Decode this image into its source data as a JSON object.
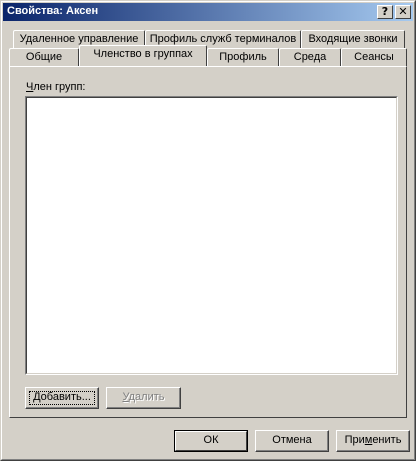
{
  "window": {
    "title": "Свойства: Аксен",
    "help_glyph": "?",
    "close_glyph": "✕"
  },
  "tabs_row1": [
    {
      "label": "Удаленное управление"
    },
    {
      "label": "Профиль служб терминалов"
    },
    {
      "label": "Входящие звонки"
    }
  ],
  "tabs_row2": [
    {
      "label": "Общие"
    },
    {
      "label": "Членство в группах",
      "active": true
    },
    {
      "label": "Профиль"
    },
    {
      "label": "Среда"
    },
    {
      "label": "Сеансы"
    }
  ],
  "groups": {
    "label_accel": "Ч",
    "label_rest": "лен групп:",
    "items": []
  },
  "buttons": {
    "add_accel": "Д",
    "add_rest": "обавить...",
    "remove_accel": "У",
    "remove_rest": "далить",
    "ok": "ОК",
    "cancel": "Отмена",
    "apply_pre": "При",
    "apply_accel": "м",
    "apply_post": "енить"
  }
}
